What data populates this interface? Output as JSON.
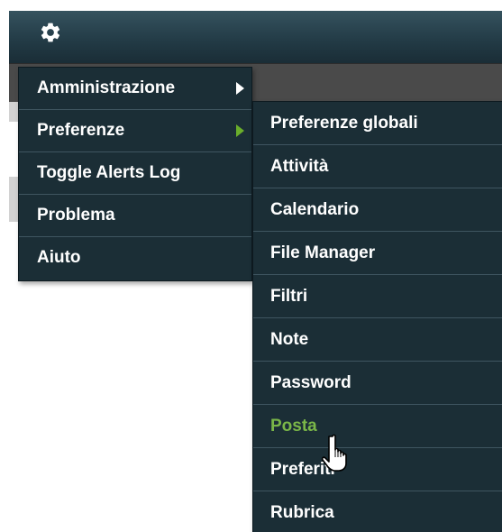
{
  "toolbar": {
    "settings_icon": "gear-icon"
  },
  "main_menu": {
    "items": [
      {
        "label": "Amministrazione",
        "has_submenu": true,
        "active": false
      },
      {
        "label": "Preferenze",
        "has_submenu": true,
        "active": true
      },
      {
        "label": "Toggle Alerts Log",
        "has_submenu": false,
        "active": false
      },
      {
        "label": "Problema",
        "has_submenu": false,
        "active": false
      },
      {
        "label": "Aiuto",
        "has_submenu": false,
        "active": false
      }
    ]
  },
  "preferences_submenu": {
    "items": [
      {
        "label": "Preferenze globali"
      },
      {
        "label": "Attività"
      },
      {
        "label": "Calendario"
      },
      {
        "label": "File Manager"
      },
      {
        "label": "Filtri"
      },
      {
        "label": "Note"
      },
      {
        "label": "Password"
      },
      {
        "label": "Posta",
        "hovered": true
      },
      {
        "label": "Preferiti"
      },
      {
        "label": "Rubrica"
      }
    ]
  },
  "colors": {
    "menu_background": "#1b2e36",
    "menu_text": "#ffffff",
    "hover_text": "#7ab648",
    "submenu_arrow_active": "#6aae2b",
    "toolbar_background": "#223a45"
  }
}
